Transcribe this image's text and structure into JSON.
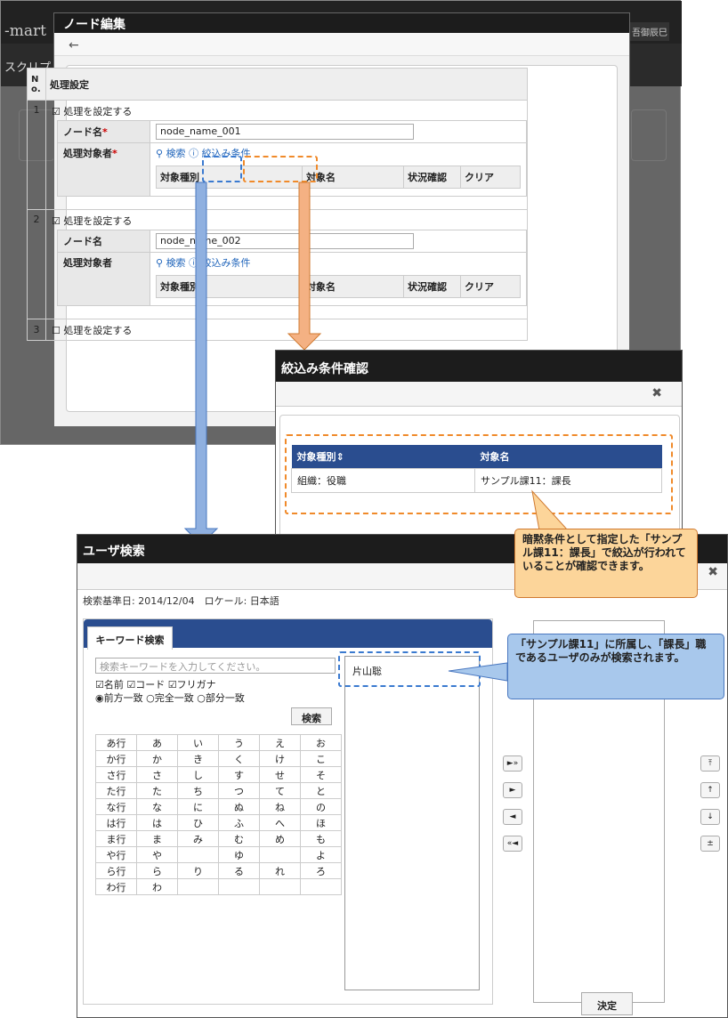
{
  "background_app": {
    "logo": "-mart",
    "menu": "スクリプ",
    "user": "吾御辰巳"
  },
  "node_edit": {
    "title": "ノード編集",
    "back_icon": "arrow-left-icon",
    "col_no": "N o.",
    "col_settings": "処理設定",
    "rows": [
      {
        "no": "1",
        "checked": true,
        "check_label": "処理を設定する",
        "name_label": "ノード名",
        "name_required": "*",
        "name_value": "node_name_001",
        "target_label": "処理対象者",
        "target_required": "*",
        "search_link": "検索",
        "filter_link": "絞込み条件",
        "cols": [
          "対象種別",
          "対象名",
          "状況確認",
          "クリア"
        ]
      },
      {
        "no": "2",
        "checked": true,
        "check_label": "処理を設定する",
        "name_label": "ノード名",
        "name_value": "node_name_002",
        "target_label": "処理対象者",
        "search_link": "検索",
        "filter_link": "絞込み条件",
        "cols": [
          "対象種別",
          "対象名",
          "状況確認",
          "クリア"
        ]
      },
      {
        "no": "3",
        "checked": false,
        "check_label": "処理を設定する"
      }
    ]
  },
  "filter_dialog": {
    "title": "絞込み条件確認",
    "columns": [
      "対象種別",
      "対象名"
    ],
    "sort_icon": "sort-icon",
    "rows": [
      {
        "type": "組織：役職",
        "name": "サンプル課11：課長"
      }
    ]
  },
  "user_search": {
    "title": "ユーザ検索",
    "info": "検索基準日: 2014/12/04　ロケール: 日本語",
    "tab": "キーワード検索",
    "placeholder": "検索キーワードを入力してください。",
    "fields": [
      "名前",
      "コード",
      "フリガナ"
    ],
    "match": [
      "前方一致",
      "完全一致",
      "部分一致"
    ],
    "search_button": "検索",
    "kana": [
      [
        "あ行",
        "あ",
        "い",
        "う",
        "え",
        "お"
      ],
      [
        "か行",
        "か",
        "き",
        "く",
        "け",
        "こ"
      ],
      [
        "さ行",
        "さ",
        "し",
        "す",
        "せ",
        "そ"
      ],
      [
        "た行",
        "た",
        "ち",
        "つ",
        "て",
        "と"
      ],
      [
        "な行",
        "な",
        "に",
        "ぬ",
        "ね",
        "の"
      ],
      [
        "は行",
        "は",
        "ひ",
        "ふ",
        "へ",
        "ほ"
      ],
      [
        "ま行",
        "ま",
        "み",
        "む",
        "め",
        "も"
      ],
      [
        "や行",
        "や",
        "",
        "ゆ",
        "",
        "よ"
      ],
      [
        "ら行",
        "ら",
        "り",
        "る",
        "れ",
        "ろ"
      ],
      [
        "わ行",
        "わ",
        "",
        "",
        "",
        ""
      ]
    ],
    "results": [
      "片山聡"
    ],
    "move_buttons": [
      "►»",
      "►",
      "◄",
      "«◄"
    ],
    "order_buttons": [
      "⤒",
      "↑",
      "↓",
      "±"
    ],
    "decide_button": "決定"
  },
  "callouts": {
    "filter_note": "暗黙条件として指定した「サンプル課11：課長」で絞込が行われていることが確認できます。",
    "result_note": "「サンプル課11」に所属し、「課長」職であるユーザのみが検索されます。"
  },
  "colors": {
    "accent_blue": "#2a4d8f",
    "callout_orange": "#fcd59a",
    "callout_blue": "#a8c8ec",
    "arrow_orange": "#f4b183",
    "arrow_blue": "#8fb0e0"
  }
}
